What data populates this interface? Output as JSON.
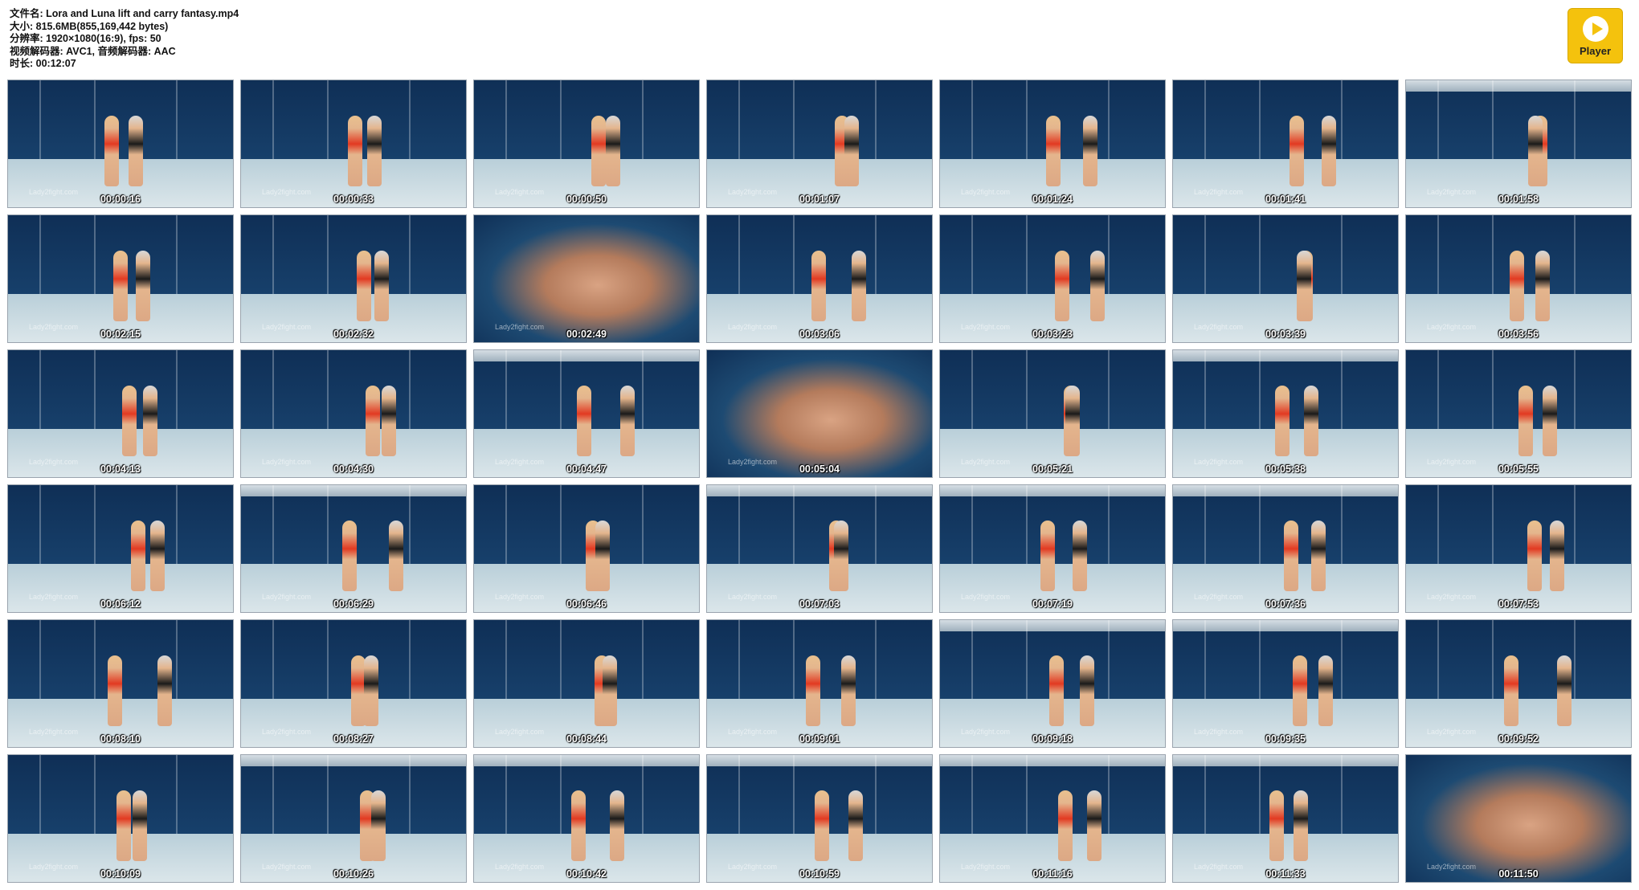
{
  "info": {
    "lines": [
      "文件名: Lora and Luna lift and carry fantasy.mp4",
      "大小: 815.6MB(855,169,442 bytes)",
      "分辨率: 1920×1080(16:9), fps: 50",
      "视频解码器: AVC1, 音频解码器: AAC",
      "时长: 00:12:07"
    ]
  },
  "player_button": {
    "label": "Player",
    "icon": "play-icon",
    "color": "#f4c20d"
  },
  "watermark": "Lady2fight.com",
  "thumbnails": [
    "00:00:16",
    "00:00:33",
    "00:00:50",
    "00:01:07",
    "00:01:24",
    "00:01:41",
    "00:01:58",
    "00:02:15",
    "00:02:32",
    "00:02:49",
    "00:03:06",
    "00:03:23",
    "00:03:39",
    "00:03:56",
    "00:04:13",
    "00:04:30",
    "00:04:47",
    "00:05:04",
    "00:05:21",
    "00:05:38",
    "00:05:55",
    "00:06:12",
    "00:06:29",
    "00:06:46",
    "00:07:03",
    "00:07:19",
    "00:07:36",
    "00:07:53",
    "00:08:10",
    "00:08:27",
    "00:08:44",
    "00:09:01",
    "00:09:18",
    "00:09:35",
    "00:09:52",
    "00:10:09",
    "00:10:26",
    "00:10:42",
    "00:10:59",
    "00:11:16",
    "00:11:33",
    "00:11:50"
  ]
}
